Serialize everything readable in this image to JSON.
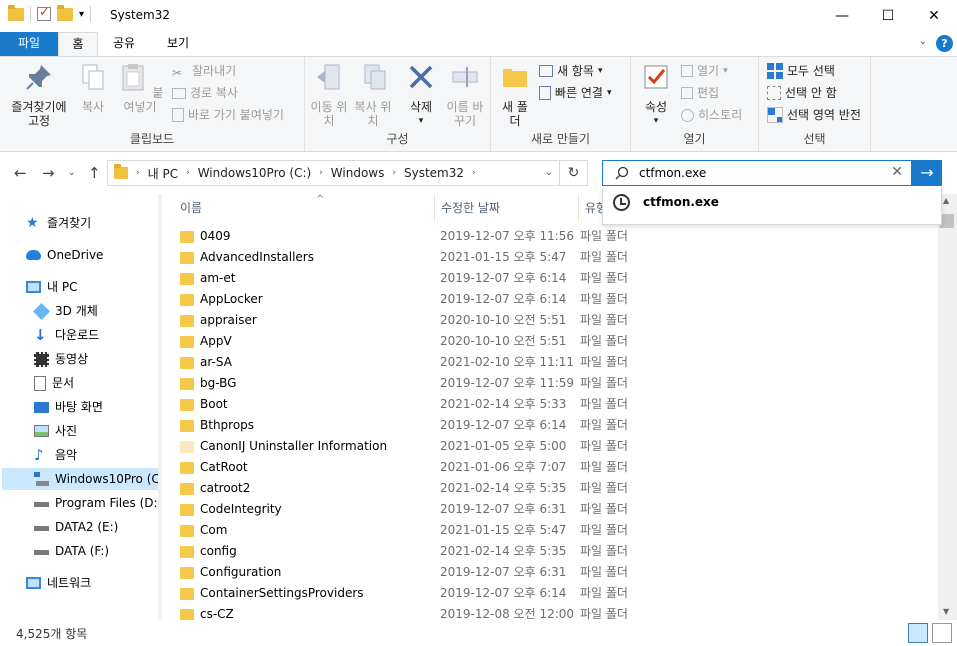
{
  "window": {
    "title": "System32"
  },
  "window_controls": {
    "minimize": "—",
    "maximize": "☐",
    "close": "✕"
  },
  "tabs": {
    "file": "파일",
    "home": "홈",
    "share": "공유",
    "view": "보기"
  },
  "ribbon": {
    "clipboard": {
      "label": "클립보드",
      "pin": "즐겨찾기에 고정",
      "copy": "복사",
      "paste": "붙여넣기",
      "cut": "잘라내기",
      "copy_path": "경로 복사",
      "paste_shortcut": "바로 가기 붙여넣기"
    },
    "organize": {
      "label": "구성",
      "move_to": "이동 위치",
      "copy_to": "복사 위치",
      "delete": "삭제",
      "rename": "이름 바꾸기"
    },
    "new": {
      "label": "새로 만들기",
      "new_folder": "새 폴더",
      "new_item": "새 항목",
      "easy_access": "빠른 연결"
    },
    "open": {
      "label": "열기",
      "properties": "속성",
      "open": "열기",
      "edit": "편집",
      "history": "히스토리"
    },
    "select": {
      "label": "선택",
      "select_all": "모두 선택",
      "select_none": "선택 안 함",
      "invert": "선택 영역 반전"
    }
  },
  "address": {
    "crumbs": [
      "내 PC",
      "Windows10Pro (C:)",
      "Windows",
      "System32"
    ]
  },
  "search": {
    "value": "ctfmon.exe",
    "suggestion": "ctfmon.exe"
  },
  "nav": {
    "quick_access": "즐겨찾기",
    "onedrive": "OneDrive",
    "this_pc": "내 PC",
    "objects3d": "3D 개체",
    "downloads": "다운로드",
    "videos": "동영상",
    "documents": "문서",
    "desktop": "바탕 화면",
    "pictures": "사진",
    "music": "음악",
    "drive_c": "Windows10Pro (C:)",
    "drive_d": "Program Files (D:)",
    "drive_e": "DATA2 (E:)",
    "drive_f": "DATA (F:)",
    "network": "네트워크"
  },
  "columns": {
    "name": "이름",
    "date": "수정한 날짜",
    "type": "유형"
  },
  "files": [
    {
      "name": "0409",
      "date": "2019-12-07 오후 11:56",
      "type": "파일 폴더"
    },
    {
      "name": "AdvancedInstallers",
      "date": "2021-01-15 오후 5:47",
      "type": "파일 폴더"
    },
    {
      "name": "am-et",
      "date": "2019-12-07 오후 6:14",
      "type": "파일 폴더"
    },
    {
      "name": "AppLocker",
      "date": "2019-12-07 오후 6:14",
      "type": "파일 폴더"
    },
    {
      "name": "appraiser",
      "date": "2020-10-10 오전 5:51",
      "type": "파일 폴더"
    },
    {
      "name": "AppV",
      "date": "2020-10-10 오전 5:51",
      "type": "파일 폴더"
    },
    {
      "name": "ar-SA",
      "date": "2021-02-10 오후 11:11",
      "type": "파일 폴더"
    },
    {
      "name": "bg-BG",
      "date": "2019-12-07 오후 11:59",
      "type": "파일 폴더"
    },
    {
      "name": "Boot",
      "date": "2021-02-14 오후 5:33",
      "type": "파일 폴더"
    },
    {
      "name": "Bthprops",
      "date": "2019-12-07 오후 6:14",
      "type": "파일 폴더"
    },
    {
      "name": "CanonIJ Uninstaller Information",
      "date": "2021-01-05 오후 5:00",
      "type": "파일 폴더"
    },
    {
      "name": "CatRoot",
      "date": "2021-01-06 오후 7:07",
      "type": "파일 폴더"
    },
    {
      "name": "catroot2",
      "date": "2021-02-14 오후 5:35",
      "type": "파일 폴더"
    },
    {
      "name": "CodeIntegrity",
      "date": "2019-12-07 오후 6:31",
      "type": "파일 폴더"
    },
    {
      "name": "Com",
      "date": "2021-01-15 오후 5:47",
      "type": "파일 폴더"
    },
    {
      "name": "config",
      "date": "2021-02-14 오후 5:35",
      "type": "파일 폴더"
    },
    {
      "name": "Configuration",
      "date": "2019-12-07 오후 6:31",
      "type": "파일 폴더"
    },
    {
      "name": "ContainerSettingsProviders",
      "date": "2019-12-07 오후 6:14",
      "type": "파일 폴더"
    },
    {
      "name": "cs-CZ",
      "date": "2019-12-08 오전 12:00",
      "type": "파일 폴더"
    }
  ],
  "status": {
    "count": "4,525개 항목"
  }
}
